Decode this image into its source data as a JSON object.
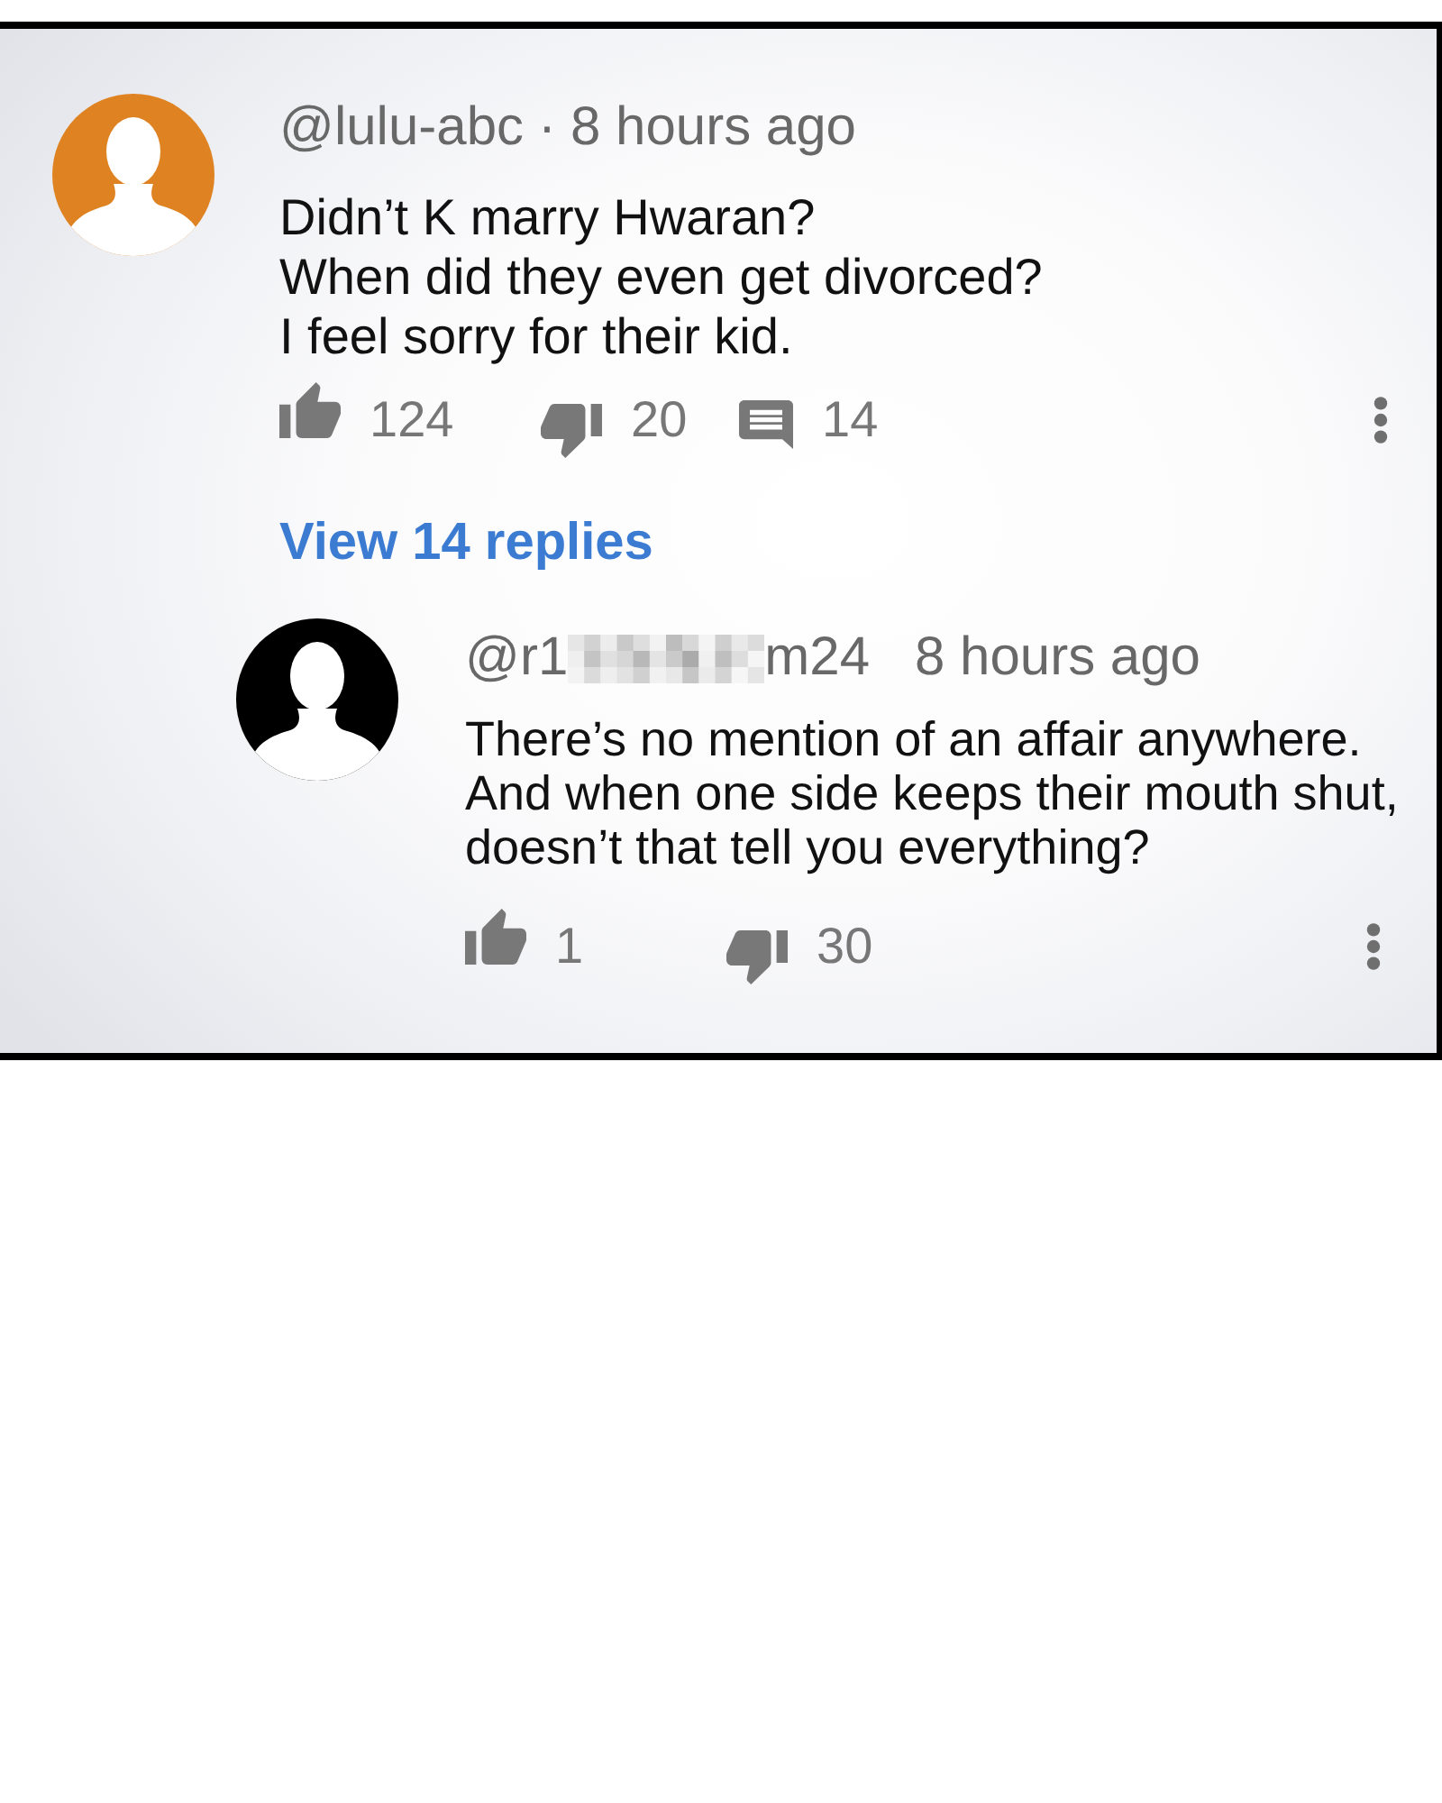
{
  "comment": {
    "avatar": {
      "color": "#df8322"
    },
    "handle": "@lulu-abc",
    "separator": "·",
    "time": "8 hours ago",
    "text": "Didn’t K marry Hwaran?\nWhen did they even get divorced?\nI feel sorry for their kid.",
    "actions": [
      {
        "kind": "like",
        "count": "124"
      },
      {
        "kind": "dislike",
        "count": "20"
      },
      {
        "kind": "reply",
        "count": "14"
      }
    ],
    "view_replies": "View 14 replies",
    "replies": [
      {
        "avatar": {
          "color": "#000000"
        },
        "handle": "@r1",
        "censored": true,
        "handle_end": "m24",
        "time": "8 hours ago",
        "text": "There’s no mention of an affair anywhere.\nAnd when one side keeps their mouth shut,\ndoesn’t that tell you everything?",
        "actions": [
          {
            "kind": "like",
            "count": "1"
          },
          {
            "kind": "dislike",
            "count": "30"
          }
        ]
      }
    ]
  }
}
